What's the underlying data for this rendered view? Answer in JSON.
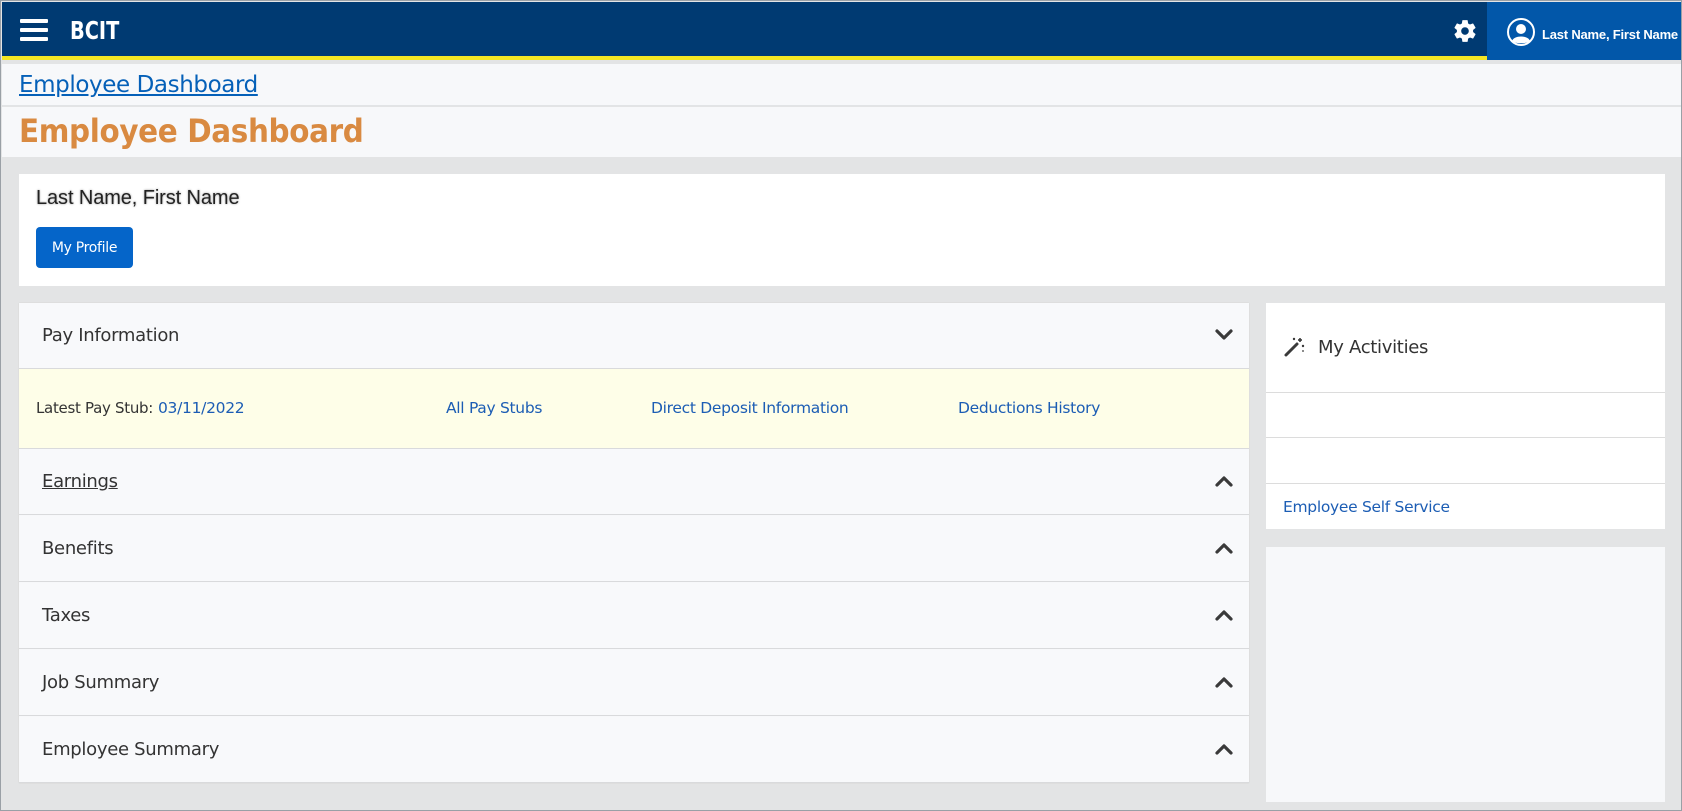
{
  "header": {
    "brand": "BCIT",
    "user_name": "Last Name, First Name"
  },
  "breadcrumb": {
    "label": "Employee Dashboard"
  },
  "page": {
    "title": "Employee Dashboard"
  },
  "profile": {
    "name": "Last Name, First Name",
    "button_label": "My Profile"
  },
  "pay_information": {
    "title": "Pay Information",
    "latest_stub_label": "Latest Pay Stub:",
    "latest_stub_date": "03/11/2022",
    "links": [
      "All Pay Stubs",
      "Direct Deposit Information",
      "Deductions History"
    ]
  },
  "sections": [
    {
      "label": "Earnings"
    },
    {
      "label": "Benefits"
    },
    {
      "label": "Taxes"
    },
    {
      "label": "Job Summary"
    },
    {
      "label": "Employee Summary"
    }
  ],
  "activities": {
    "title": "My Activities",
    "link": "Employee Self Service"
  },
  "colors": {
    "nav_bg": "#003a72",
    "nav_accent": "#f4e623",
    "user_bg": "#0257a9",
    "title_orange": "#d98a41",
    "link_blue": "#1c5db4",
    "button_blue": "#0565c9",
    "pay_links_bg": "#fefee8"
  },
  "icons": {
    "menu": "hamburger-menu-icon",
    "settings": "gear-icon",
    "user": "user-avatar-icon",
    "expanded": "chevron-down-icon",
    "collapsed": "chevron-up-icon",
    "activities": "magic-wand-icon"
  }
}
